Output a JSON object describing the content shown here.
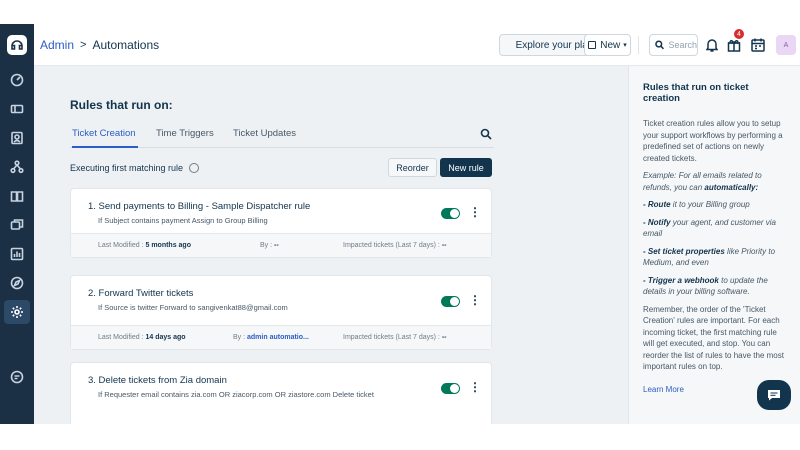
{
  "header": {
    "breadcrumb_root": "Admin",
    "breadcrumb_sep": ">",
    "breadcrumb_current": "Automations",
    "explore_label": "Explore your plan",
    "new_label": "New",
    "search_placeholder": "Search",
    "notification_count": "4",
    "avatar_initial": "A"
  },
  "main": {
    "title": "Rules that run on:",
    "tabs": [
      {
        "label": "Ticket Creation",
        "active": true
      },
      {
        "label": "Time Triggers",
        "active": false
      },
      {
        "label": "Ticket Updates",
        "active": false
      }
    ],
    "exec_label": "Executing first matching rule",
    "reorder_label": "Reorder",
    "new_rule_label": "New rule",
    "rules": [
      {
        "title": "1.  Send payments to Billing - Sample Dispatcher rule",
        "desc": "If Subject contains payment Assign to Group Billing",
        "enabled": true,
        "last_modified_label": "Last Modified :",
        "last_modified_value": "5 months ago",
        "by_label": "By :",
        "by_value": "--",
        "impacted_label": "Impacted tickets (Last 7 days) :",
        "impacted_value": "--"
      },
      {
        "title": "2.  Forward Twitter tickets",
        "desc": "If Source is twitter Forward to sangivenkat88@gmail.com",
        "enabled": true,
        "last_modified_label": "Last Modified :",
        "last_modified_value": "14 days ago",
        "by_label": "By :",
        "by_value": "admin automatio...",
        "impacted_label": "Impacted tickets (Last 7 days) :",
        "impacted_value": "--"
      },
      {
        "title": "3.  Delete tickets from Zia domain",
        "desc": "If Requester email contains zia.com OR ziacorp.com OR ziastore.com Delete ticket",
        "enabled": true
      }
    ]
  },
  "help": {
    "title": "Rules that run on ticket creation",
    "intro": "Ticket creation rules allow you to setup your support workflows by performing a predefined set of actions on newly created tickets.",
    "example_prefix": "Example: For all emails related to refunds, you can ",
    "example_bold": "automatically:",
    "b1_bold": "- Route",
    "b1_rest": " it to your Billing group",
    "b2_bold": "- Notify",
    "b2_rest": " your agent, and customer via email",
    "b3_bold": "- Set ticket properties",
    "b3_rest": " like Priority to Medium, and even",
    "b4_bold": "- Trigger a webhook",
    "b4_rest": " to update the details in your billing software.",
    "outro": "Remember, the order of the 'Ticket Creation' rules are important. For each incoming ticket, the first matching rule will get executed, and stop. You can reorder the list of rules to have the most important rules on top.",
    "learn_more": "Learn More"
  },
  "colors": {
    "rail_bg": "#1b2f45",
    "accent": "#2c5cc5",
    "toggle_on": "#00795b",
    "primary_btn": "#12344d"
  }
}
